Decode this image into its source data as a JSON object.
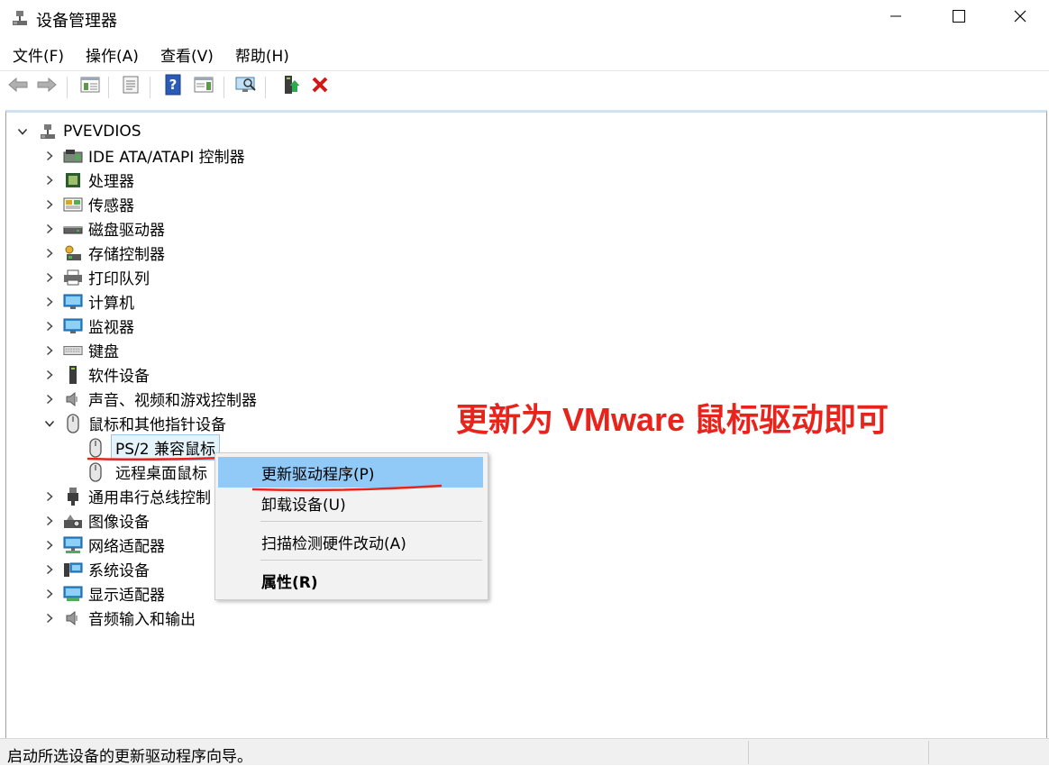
{
  "window": {
    "title": "设备管理器",
    "controls": {
      "minimize": "minimize-icon",
      "maximize": "maximize-icon",
      "close": "close-icon"
    }
  },
  "menubar": [
    {
      "label": "文件(F)"
    },
    {
      "label": "操作(A)"
    },
    {
      "label": "查看(V)"
    },
    {
      "label": "帮助(H)"
    }
  ],
  "toolbar": {
    "icons": [
      "back-arrow-icon",
      "forward-arrow-icon",
      "show-hide-tree-icon",
      "properties-icon",
      "help-icon",
      "action-pane-icon",
      "scan-hardware-icon",
      "update-driver-icon",
      "uninstall-icon"
    ]
  },
  "tree": {
    "root": "PVEVDIOS",
    "categories": [
      {
        "label": "IDE ATA/ATAPI 控制器",
        "icon": "ide-controller-icon"
      },
      {
        "label": "处理器",
        "icon": "processor-icon"
      },
      {
        "label": "传感器",
        "icon": "sensor-icon"
      },
      {
        "label": "磁盘驱动器",
        "icon": "disk-drive-icon"
      },
      {
        "label": "存储控制器",
        "icon": "storage-controller-icon"
      },
      {
        "label": "打印队列",
        "icon": "printer-icon"
      },
      {
        "label": "计算机",
        "icon": "computer-icon"
      },
      {
        "label": "监视器",
        "icon": "monitor-icon"
      },
      {
        "label": "键盘",
        "icon": "keyboard-icon"
      },
      {
        "label": "软件设备",
        "icon": "software-device-icon"
      },
      {
        "label": "声音、视频和游戏控制器",
        "icon": "sound-icon"
      },
      {
        "label": "鼠标和其他指针设备",
        "icon": "mouse-icon",
        "expanded": true,
        "children": [
          {
            "label": "PS/2 兼容鼠标",
            "icon": "mouse-icon",
            "selected": true
          },
          {
            "label": "远程桌面鼠标",
            "icon": "mouse-icon"
          }
        ]
      },
      {
        "label": "通用串行总线控制",
        "icon": "usb-icon"
      },
      {
        "label": "图像设备",
        "icon": "imaging-device-icon"
      },
      {
        "label": "网络适配器",
        "icon": "network-adapter-icon"
      },
      {
        "label": "系统设备",
        "icon": "system-device-icon"
      },
      {
        "label": "显示适配器",
        "icon": "display-adapter-icon"
      },
      {
        "label": "音频输入和输出",
        "icon": "audio-io-icon"
      }
    ]
  },
  "context_menu": {
    "items": [
      {
        "label": "更新驱动程序(P)",
        "highlighted": true
      },
      {
        "label": "卸载设备(U)"
      },
      {
        "label": "扫描检测硬件改动(A)"
      },
      {
        "label": "属性(R)",
        "bold": true
      }
    ]
  },
  "annotation": {
    "text": "更新为 VMware 鼠标驱动即可",
    "color": "#e8231c"
  },
  "statusbar": {
    "text": "启动所选设备的更新驱动程序向导。"
  },
  "colors": {
    "accent_highlight": "#91c9f7",
    "selection_bg": "#e5f3fb",
    "annotation_red": "#e8231c"
  }
}
